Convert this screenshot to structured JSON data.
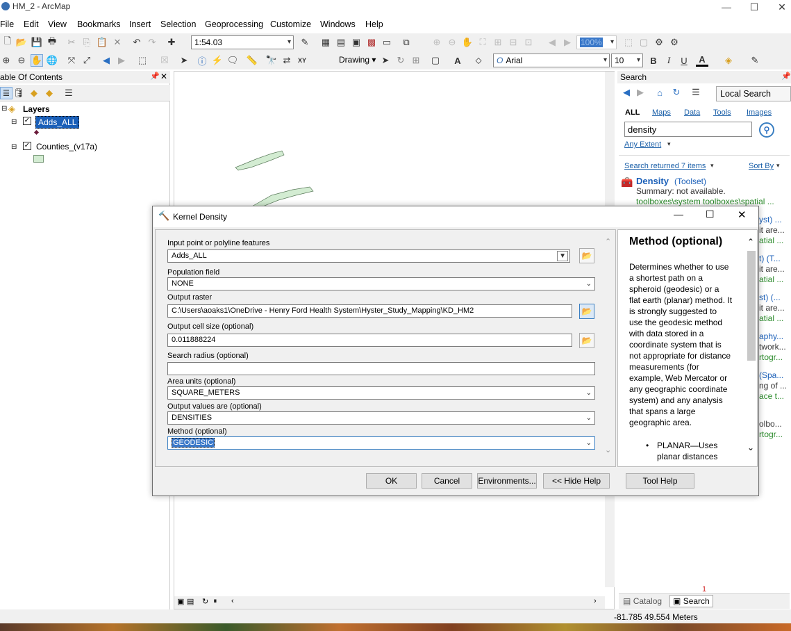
{
  "window": {
    "title": "HM_2 - ArcMap",
    "min": "—",
    "max": "☐",
    "close": "✕"
  },
  "menu": [
    "File",
    "Edit",
    "View",
    "Bookmarks",
    "Insert",
    "Selection",
    "Geoprocessing",
    "Customize",
    "Windows",
    "Help"
  ],
  "toolbar": {
    "scale": "1:54.03",
    "zoom_pct": "100%",
    "drawing": "Drawing",
    "font": "Arial",
    "font_size": "10",
    "bold": "B",
    "italic": "I",
    "underline": "U",
    "text_a": "A"
  },
  "toc": {
    "title": "able Of Contents",
    "pin": "⊥",
    "close": "✕",
    "layers_label": "Layers",
    "items": [
      {
        "label": "Adds_ALL",
        "checked": true,
        "selected": true
      },
      {
        "label": "Counties_(v17a)",
        "checked": true,
        "selected": false
      }
    ]
  },
  "search": {
    "title": "Search",
    "local_search": "Local Search",
    "tabs": [
      "ALL",
      "Maps",
      "Data",
      "Tools",
      "Images"
    ],
    "query": "density",
    "extent": "Any Extent",
    "returned": "Search returned 7 items",
    "sort_by": "Sort By",
    "result": {
      "title": "Density",
      "type": "(Toolset)",
      "summary": "Summary: not available.",
      "path": "toolboxes\\system toolboxes\\spatial ..."
    },
    "fragments": [
      "yst) ...",
      "it are...",
      "atial ...",
      "t) (T...",
      "it are...",
      "atial ...",
      "st) (...",
      "it are...",
      "atial ...",
      "aphy...",
      "twork...",
      "rtogr...",
      "(Spa...",
      "ng of ...",
      "ace t...",
      "olbo...",
      "rtogr..."
    ],
    "bottom_tabs": [
      "Catalog",
      "Search"
    ],
    "badge": "1"
  },
  "dialog": {
    "title": "Kernel Density",
    "fields": [
      {
        "label": "Input point or polyline features",
        "value": "Adds_ALL"
      },
      {
        "label": "Population field",
        "value": "NONE"
      },
      {
        "label": "Output raster",
        "value": "C:\\Users\\aoaks1\\OneDrive - Henry Ford Health System\\Hyster_Study_Mapping\\KD_HM2"
      },
      {
        "label": "Output cell size (optional)",
        "value": "0.011888224"
      },
      {
        "label": "Search radius (optional)",
        "value": ""
      },
      {
        "label": "Area units (optional)",
        "value": "SQUARE_METERS"
      },
      {
        "label": "Output values are (optional)",
        "value": "DENSITIES"
      },
      {
        "label": "Method (optional)",
        "value": "GEODESIC"
      }
    ],
    "help": {
      "heading": "Method (optional)",
      "lines": [
        "Determines whether to use",
        "a shortest path on a",
        "spheroid (geodesic) or a",
        "flat earth (planar) method. It",
        "is strongly suggested to",
        "use the geodesic method",
        "with data stored in a",
        "coordinate system that is",
        "not appropriate for distance",
        "measurements (for",
        "example, Web Mercator or",
        "any geographic coordinate",
        "system) and any analysis",
        "that spans a large",
        "geographic area."
      ],
      "bullet1": "PLANAR—Uses",
      "bullet2": "planar distances"
    },
    "buttons": {
      "ok": "OK",
      "cancel": "Cancel",
      "env": "Environments...",
      "hide": "<< Hide Help",
      "toolhelp": "Tool Help"
    }
  },
  "status": {
    "coords": "-81.785  49.554 Meters"
  }
}
